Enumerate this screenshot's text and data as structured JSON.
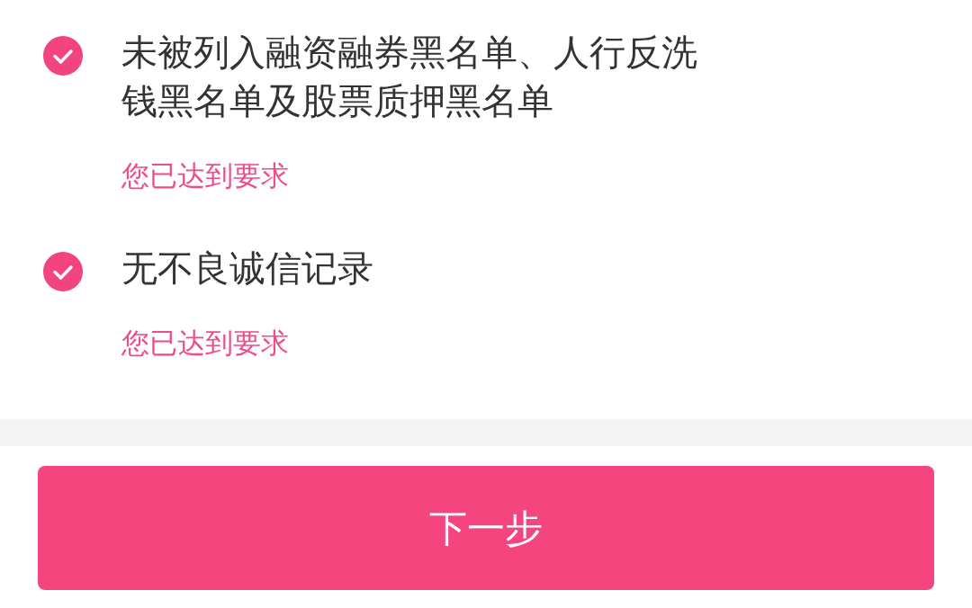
{
  "requirements": [
    {
      "title": "未被列入融资融券黑名单、人行反洗钱黑名单及股票质押黑名单",
      "checked": true,
      "status": "您已达到要求"
    },
    {
      "title": "无不良诚信记录",
      "checked": true,
      "status": "您已达到要求"
    }
  ],
  "next_button": {
    "label": "下一步"
  }
}
